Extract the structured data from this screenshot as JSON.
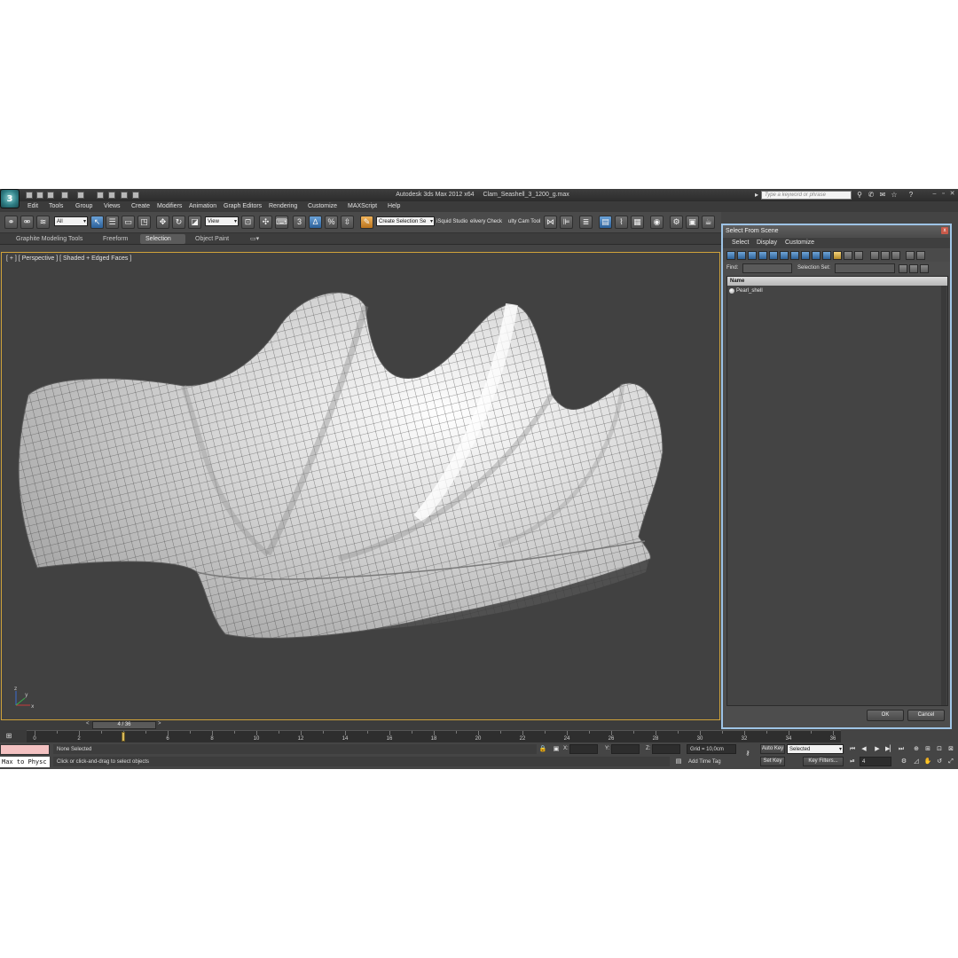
{
  "title_bar": {
    "app_name": "Autodesk 3ds Max  2012 x64",
    "file_name": "Clam_Seashell_3_1200_g.max",
    "search_placeholder": "Type a keyword or phrase",
    "logo_label": "3",
    "help_label": "?"
  },
  "menu": [
    "Edit",
    "Tools",
    "Group",
    "Views",
    "Create",
    "Modifiers",
    "Animation",
    "Graph Editors",
    "Rendering",
    "Customize",
    "MAXScript",
    "Help"
  ],
  "main_toolbar": {
    "selection_filter": "All",
    "reference_coord": "View",
    "named_selection": "Create Selection Se",
    "studio_items": [
      "iSquid Studio",
      "elivery Check",
      "ulty Cam Tool"
    ],
    "snap_3": "3",
    "snap_percent": "%",
    "snap_angle": "∆"
  },
  "ribbon": {
    "tabs": [
      "Graphite Modeling Tools",
      "Freeform",
      "Selection",
      "Object Paint"
    ],
    "active_tab": "Selection"
  },
  "viewport": {
    "label": "[ + ] [ Perspective ] [ Shaded + Edged Faces ]",
    "gizmo_axes": [
      "x",
      "y",
      "z"
    ]
  },
  "time_slider": {
    "position": "4 / 36",
    "current_frame": 4,
    "total_frames": 36,
    "prev": "<",
    "next": ">"
  },
  "track_ticks": [
    "0",
    "2",
    "4",
    "6",
    "8",
    "10",
    "12",
    "14",
    "16",
    "18",
    "20",
    "22",
    "24",
    "26",
    "28",
    "30",
    "32",
    "34",
    "36"
  ],
  "status_bar": {
    "maxscript_text": "Max to Physc",
    "selection_status": "None Selected",
    "prompt": "Click or click-and-drag to select objects",
    "x_label": "X:",
    "y_label": "Y:",
    "z_label": "Z:",
    "grid": "Grid = 10,0cm",
    "add_time_tag": "Add Time Tag",
    "auto_key": "Auto Key",
    "set_key": "Set Key",
    "key_mode_value": "Selected",
    "key_filters": "Key Filters...",
    "frame_field": "4"
  },
  "select_dialog": {
    "title": "Select From Scene",
    "close": "x",
    "menus": [
      "Select",
      "Display",
      "Customize"
    ],
    "find_label": "Find:",
    "selection_set_label": "Selection Set:",
    "column_header": "Name",
    "objects": [
      "Pearl_shell"
    ],
    "ok_label": "OK",
    "cancel_label": "Cancel"
  },
  "colors": {
    "viewport_border": "#cfa23a",
    "dialog_border": "#9ec4e6",
    "active_tool_blue": "#2b5f98"
  }
}
